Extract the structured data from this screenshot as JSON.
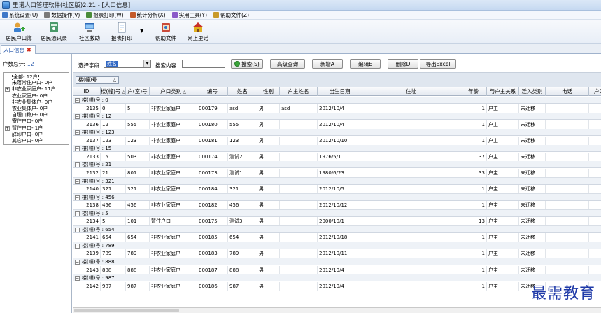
{
  "window": {
    "title": "里诺人口管理软件(社区版)2.21 - [人口信息]"
  },
  "menu": [
    {
      "label": "系统设置(U)",
      "color": "#3f78c8"
    },
    {
      "label": "数据操作(V)",
      "color": "#7a7a7a"
    },
    {
      "label": "报表打印(W)",
      "color": "#4a8c3a"
    },
    {
      "label": "统计分析(X)",
      "color": "#c45a2a"
    },
    {
      "label": "实用工具(Y)",
      "color": "#8a5ac8"
    },
    {
      "label": "帮助文件(Z)",
      "color": "#c89a2a"
    }
  ],
  "toolbar": {
    "resident_register": "居民户口簿",
    "resident_contacts": "居民通讯录",
    "community_aid": "社区救助",
    "report_print": "报表打印",
    "help_file": "帮助文件",
    "online_lino": "网上里诺"
  },
  "tab": {
    "label": "人口信息"
  },
  "left": {
    "total_label": "户数总计:",
    "total_value": "12",
    "tree": [
      {
        "label": "全部- 12户",
        "expand": "",
        "selected": true
      },
      {
        "label": "未落常住户口- 0户",
        "expand": ""
      },
      {
        "label": "非农业家庭户- 11户",
        "expand": "+"
      },
      {
        "label": "农业家庭户- 0户",
        "expand": ""
      },
      {
        "label": "非农业集体户- 0户",
        "expand": ""
      },
      {
        "label": "农业集体户- 0户",
        "expand": ""
      },
      {
        "label": "自理口粮户- 0户",
        "expand": ""
      },
      {
        "label": "寄住户口- 0户",
        "expand": ""
      },
      {
        "label": "暂住户口- 1户",
        "expand": "+"
      },
      {
        "label": "辞印户口- 0户",
        "expand": ""
      },
      {
        "label": "其它户口- 0户",
        "expand": ""
      }
    ]
  },
  "search": {
    "field_label": "选择字段",
    "field_value": "姓名",
    "content_label": "搜索内容",
    "search_btn": "搜索(S)",
    "advanced_btn": "高级查询",
    "add_btn": "新增A",
    "edit_btn": "编辑E",
    "delete_btn": "删除D",
    "export_btn": "导出Excel"
  },
  "group_panel": {
    "chip": "楼(幢)号"
  },
  "grid": {
    "columns": [
      "ID",
      "楼(幢)号",
      "户(室)号",
      "户口类别",
      "编号",
      "姓名",
      "性别",
      "户主姓名",
      "出生日期",
      "住址",
      "年龄",
      "与户主关系",
      "迁入类别",
      "电话",
      "户口"
    ],
    "groups": [
      {
        "label": "楼(幢)号 : 0",
        "row": [
          "2135",
          "0",
          "5",
          "非农业家庭户",
          "000179",
          "asd",
          "男",
          "asd",
          "2012/10/4",
          "",
          "1",
          "户主",
          "未迁移",
          "",
          ""
        ]
      },
      {
        "label": "楼(幢)号 : 12",
        "row": [
          "2136",
          "12",
          "555",
          "非农业家庭户",
          "000180",
          "555",
          "男",
          "",
          "2012/10/4",
          "",
          "1",
          "户主",
          "未迁移",
          "",
          ""
        ]
      },
      {
        "label": "楼(幢)号 : 123",
        "row": [
          "2137",
          "123",
          "123",
          "非农业家庭户",
          "000181",
          "123",
          "男",
          "",
          "2012/10/10",
          "",
          "1",
          "户主",
          "未迁移",
          "",
          ""
        ]
      },
      {
        "label": "楼(幢)号 : 15",
        "row": [
          "2133",
          "15",
          "503",
          "非农业家庭户",
          "000174",
          "测试2",
          "男",
          "",
          "1976/5/1",
          "",
          "37",
          "户主",
          "未迁移",
          "",
          ""
        ]
      },
      {
        "label": "楼(幢)号 : 21",
        "row": [
          "2132",
          "21",
          "801",
          "非农业家庭户",
          "000173",
          "测试1",
          "男",
          "",
          "1980/6/23",
          "",
          "33",
          "户主",
          "未迁移",
          "",
          ""
        ]
      },
      {
        "label": "楼(幢)号 : 321",
        "row": [
          "2140",
          "321",
          "321",
          "非农业家庭户",
          "000184",
          "321",
          "男",
          "",
          "2012/10/5",
          "",
          "1",
          "户主",
          "未迁移",
          "",
          ""
        ]
      },
      {
        "label": "楼(幢)号 : 456",
        "row": [
          "2138",
          "456",
          "456",
          "非农业家庭户",
          "000182",
          "456",
          "男",
          "",
          "2012/10/12",
          "",
          "1",
          "户主",
          "未迁移",
          "",
          ""
        ]
      },
      {
        "label": "楼(幢)号 : 5",
        "row": [
          "2134",
          "5",
          "101",
          "暂住户口",
          "000175",
          "测试3",
          "男",
          "",
          "2000/10/1",
          "",
          "13",
          "户主",
          "未迁移",
          "",
          ""
        ]
      },
      {
        "label": "楼(幢)号 : 654",
        "row": [
          "2141",
          "654",
          "654",
          "非农业家庭户",
          "000185",
          "654",
          "男",
          "",
          "2012/10/18",
          "",
          "1",
          "户主",
          "未迁移",
          "",
          ""
        ]
      },
      {
        "label": "楼(幢)号 : 789",
        "row": [
          "2139",
          "789",
          "789",
          "非农业家庭户",
          "000183",
          "789",
          "男",
          "",
          "2012/10/11",
          "",
          "1",
          "户主",
          "未迁移",
          "",
          ""
        ]
      },
      {
        "label": "楼(幢)号 : 888",
        "row": [
          "2143",
          "888",
          "888",
          "非农业家庭户",
          "000187",
          "888",
          "男",
          "",
          "2012/10/4",
          "",
          "1",
          "户主",
          "未迁移",
          "",
          ""
        ]
      },
      {
        "label": "楼(幢)号 : 987",
        "row": [
          "2142",
          "987",
          "987",
          "非农业家庭户",
          "000186",
          "987",
          "男",
          "",
          "2012/10/4",
          "",
          "1",
          "户主",
          "未迁移",
          "",
          ""
        ]
      }
    ]
  },
  "watermark": "最需教育",
  "colors": {
    "accent": "#1c4fa6",
    "close": "#d12a1a",
    "watermark": "#1f3aa8"
  }
}
